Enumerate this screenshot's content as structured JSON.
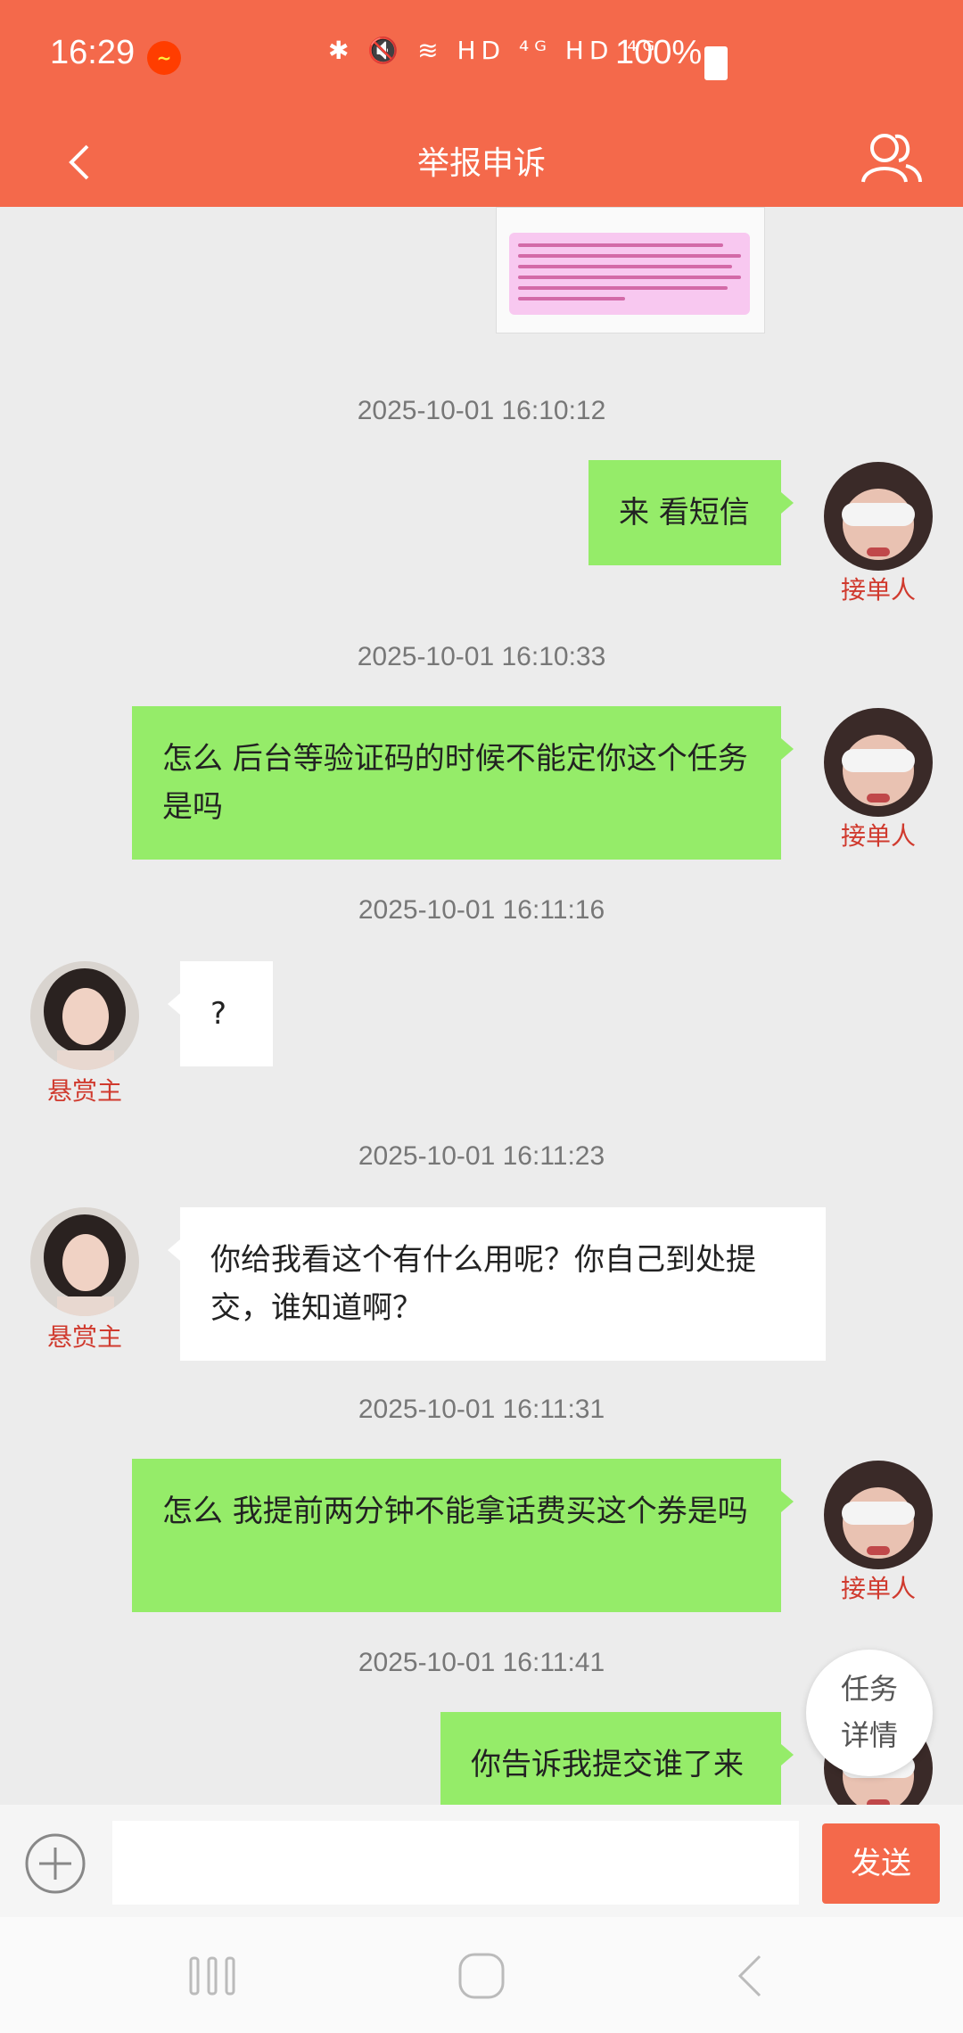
{
  "status_bar": {
    "time": "16:29",
    "icons": "✱ 🔇 ≋ HD ⁴ᴳ HD ⁴ᴳ",
    "battery": "100%"
  },
  "header": {
    "title": "举报申诉",
    "back_icon": "chevron-left-icon",
    "right_icon": "users-icon"
  },
  "messages": [
    {
      "timestamp": "2025-10-01 16:10:12",
      "text": "来 看短信",
      "role": "接单人"
    },
    {
      "timestamp": "2025-10-01 16:10:33",
      "text": "怎么 后台等验证码的时候不能定你这个任务是吗",
      "role": "接单人"
    },
    {
      "timestamp": "2025-10-01 16:11:16",
      "text": "?",
      "role": "悬赏主"
    },
    {
      "timestamp": "2025-10-01 16:11:23",
      "text": "你给我看这个有什么用呢？你自己到处提交，谁知道啊？",
      "role": "悬赏主"
    },
    {
      "timestamp": "2025-10-01 16:11:31",
      "text": "怎么 我提前两分钟不能拿话费买这个券是吗",
      "role": "接单人"
    },
    {
      "timestamp": "2025-10-01 16:11:41",
      "text": "你告诉我提交谁了来",
      "role": "接单人"
    }
  ],
  "float_button": {
    "line1": "任务",
    "line2": "详情"
  },
  "input_bar": {
    "placeholder": "",
    "send_label": "发送"
  },
  "colors": {
    "accent": "#f4694b",
    "bubble_green": "#95ec69",
    "role_red": "#d03a2e"
  }
}
